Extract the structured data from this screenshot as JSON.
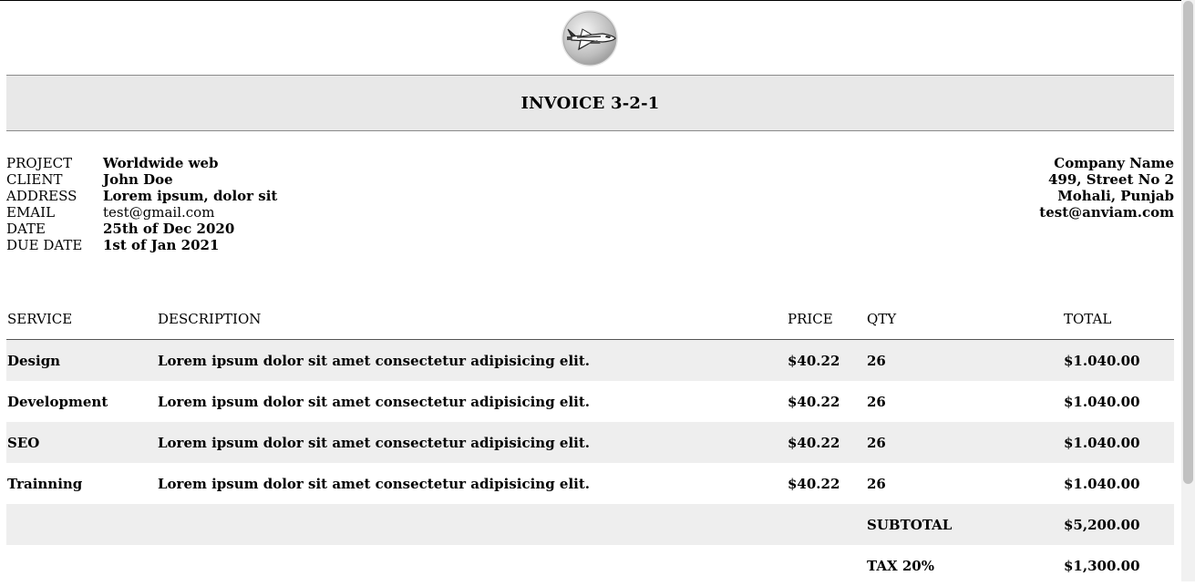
{
  "invoice": {
    "title": "INVOICE 3-2-1"
  },
  "logo": {
    "icon": "space-shuttle-icon"
  },
  "details": {
    "project_label": "PROJECT",
    "project_value": "Worldwide web",
    "client_label": "CLIENT",
    "client_value": "John Doe",
    "address_label": "ADDRESS",
    "address_value": "Lorem ipsum, dolor sit",
    "email_label": "EMAIL",
    "email_value": "test@gmail.com",
    "date_label": "DATE",
    "date_value": "25th of Dec 2020",
    "due_date_label": "DUE DATE",
    "due_date_value": "1st of Jan 2021"
  },
  "company": {
    "name": "Company Name",
    "street": "499, Street No 2",
    "city": "Mohali, Punjab",
    "email": "test@anviam.com"
  },
  "table": {
    "headers": {
      "service": "SERVICE",
      "description": "DESCRIPTION",
      "price": "PRICE",
      "qty": "QTY",
      "total": "TOTAL"
    },
    "rows": [
      {
        "service": "Design",
        "description": "Lorem ipsum dolor sit amet consectetur adipisicing elit.",
        "price": "$40.22",
        "qty": "26",
        "total": "$1.040.00"
      },
      {
        "service": "Development",
        "description": "Lorem ipsum dolor sit amet consectetur adipisicing elit.",
        "price": "$40.22",
        "qty": "26",
        "total": "$1.040.00"
      },
      {
        "service": "SEO",
        "description": "Lorem ipsum dolor sit amet consectetur adipisicing elit.",
        "price": "$40.22",
        "qty": "26",
        "total": "$1.040.00"
      },
      {
        "service": "Trainning",
        "description": "Lorem ipsum dolor sit amet consectetur adipisicing elit.",
        "price": "$40.22",
        "qty": "26",
        "total": "$1.040.00"
      }
    ],
    "subtotal_label": "SUBTOTAL",
    "subtotal_value": "$5,200.00",
    "tax_label": "TAX 20%",
    "tax_value": "$1,300.00"
  }
}
